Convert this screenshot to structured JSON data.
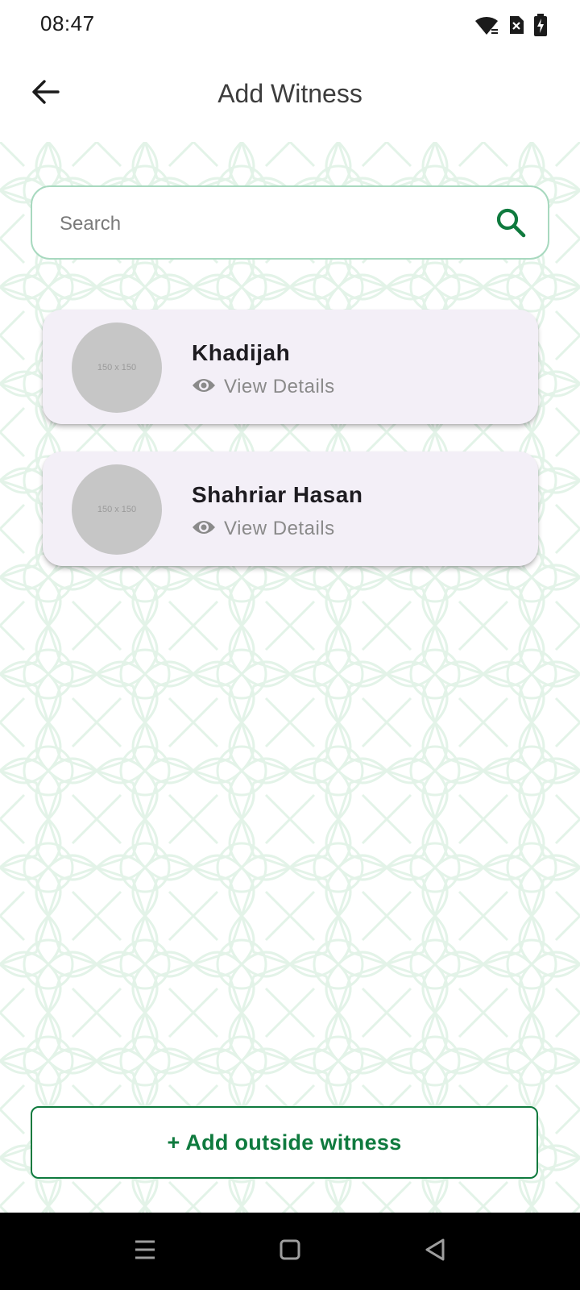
{
  "status_bar": {
    "time": "08:47"
  },
  "app_bar": {
    "title": "Add Witness"
  },
  "search": {
    "placeholder": "Search",
    "value": ""
  },
  "witnesses": [
    {
      "name": "Khadijah",
      "avatar_placeholder": "150 x 150",
      "action_label": "View Details"
    },
    {
      "name": "Shahriar Hasan",
      "avatar_placeholder": "150 x 150",
      "action_label": "View Details"
    }
  ],
  "footer": {
    "add_outside_label": "+ Add outside witness"
  },
  "colors": {
    "accent": "#0f7a3e",
    "card_bg": "#f3eff7",
    "search_border": "#a8d9bf"
  },
  "icons": [
    "wifi-icon",
    "sim-off-icon",
    "battery-charging-icon",
    "back-arrow-icon",
    "search-icon",
    "eye-icon",
    "menu-icon",
    "home-icon",
    "back-triangle-icon"
  ]
}
